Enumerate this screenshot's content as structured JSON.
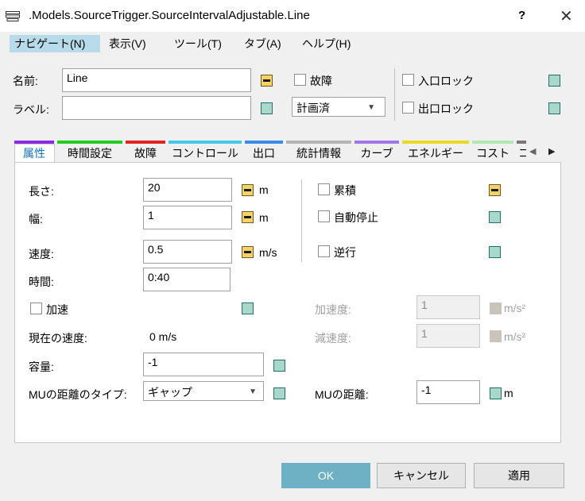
{
  "window": {
    "title": ".Models.SourceTrigger.SourceIntervalAdjustable.Line",
    "help_glyph": "?",
    "close_glyph": "✕"
  },
  "menu": [
    {
      "label": "ナビゲート(N)",
      "active": true
    },
    {
      "label": "表示(V)"
    },
    {
      "label": "ツール(T)"
    },
    {
      "label": "タブ(A)"
    },
    {
      "label": "ヘルプ(H)"
    }
  ],
  "header": {
    "name_label": "名前:",
    "name_value": "Line",
    "label_label": "ラベル:",
    "label_value": "",
    "failure_label": "故障",
    "status_combo_value": "計画済",
    "entry_lock_label": "入口ロック",
    "exit_lock_label": "出口ロック"
  },
  "tabs": [
    {
      "label": "属性",
      "color": "#8b2be2",
      "active": true
    },
    {
      "label": "時間設定",
      "color": "#22cc22"
    },
    {
      "label": "故障",
      "color": "#e52222"
    },
    {
      "label": "コントロール",
      "color": "#46c8e6"
    },
    {
      "label": "出口",
      "color": "#3c8ce6"
    },
    {
      "label": "統計情報",
      "color": "#b4b4b4"
    },
    {
      "label": "カーブ",
      "color": "#a078e6"
    },
    {
      "label": "エネルギー",
      "color": "#e6dc28"
    },
    {
      "label": "コスト",
      "color": "#b4e6b4"
    },
    {
      "label": "コ",
      "color": "#787878"
    }
  ],
  "tab_scroll": {
    "left": "◀",
    "right": "▶"
  },
  "attributes": {
    "length_label": "長さ:",
    "length_value": "20",
    "length_unit": "m",
    "width_label": "幅:",
    "width_value": "1",
    "width_unit": "m",
    "speed_label": "速度:",
    "speed_value": "0.5",
    "speed_unit": "m/s",
    "time_label": "時間:",
    "time_value": "0:40",
    "acceleration_label": "加速",
    "current_speed_label": "現在の速度:",
    "current_speed_value": "0 m/s",
    "capacity_label": "容量:",
    "capacity_value": "-1",
    "mu_distance_type_label": "MUの距離のタイプ:",
    "mu_distance_type_value": "ギャップ",
    "accumulating_label": "累積",
    "auto_stop_label": "自動停止",
    "reverse_label": "逆行",
    "accel_rate_label": "加速度:",
    "accel_rate_value": "1",
    "accel_rate_unit": "m/s²",
    "decel_rate_label": "減速度:",
    "decel_rate_value": "1",
    "decel_rate_unit": "m/s²",
    "mu_distance_label": "MUの距離:",
    "mu_distance_value": "-1",
    "mu_distance_unit": "m"
  },
  "buttons": {
    "ok": "OK",
    "cancel": "キャンセル",
    "apply": "適用"
  }
}
